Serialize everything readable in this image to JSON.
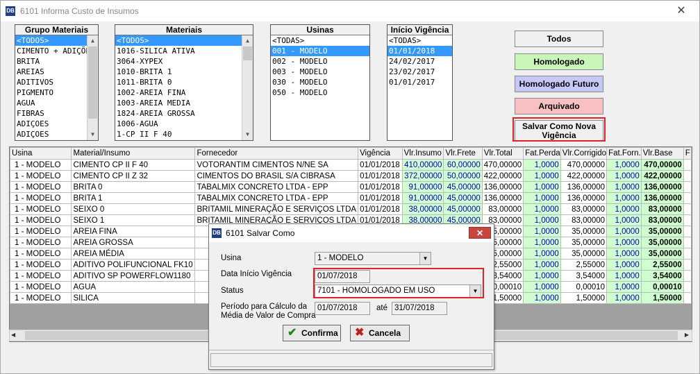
{
  "window": {
    "title": "6101 Informa Custo de Insumos",
    "icon_text": "DB",
    "close_glyph": "✕"
  },
  "lists": {
    "grupo": {
      "header": "Grupo Materiais",
      "items": [
        "<TODOS>",
        "CIMENTO + ADIÇÕES",
        "BRITA",
        "AREIAS",
        "ADITIVOS",
        "PIGMENTO",
        "AGUA",
        "FIBRAS",
        "ADIÇOES",
        "ADIÇOES"
      ],
      "selected": 0
    },
    "materiais": {
      "header": "Materiais",
      "items": [
        "<TODOS>",
        "1016-SILICA ATIVA",
        "3064-XYPEX",
        "1010-BRITA 1",
        "1011-BRITA 0",
        "1002-AREIA FINA",
        "1003-AREIA MEDIA",
        "1824-AREIA GROSSA",
        "1006-AGUA",
        "1-CP II F 40"
      ],
      "selected": 0
    },
    "usinas": {
      "header": "Usinas",
      "items": [
        "<TODAS>",
        "001 - MODELO",
        "002 - MODELO",
        "003 - MODELO",
        "030 - MODELO",
        "050 - MODELO"
      ],
      "selected": 1
    },
    "vigencia": {
      "header": "Início Vigência",
      "items": [
        "<TODAS>",
        "01/01/2018",
        "24/02/2017",
        "23/02/2017",
        "01/01/2017"
      ],
      "selected": 1
    }
  },
  "status_buttons": [
    {
      "label": "Todos",
      "bg": "#f0f0f0"
    },
    {
      "label": "Homologado",
      "bg": "#c8f5b8"
    },
    {
      "label": "Homologado Futuro",
      "bg": "#c8c8f8"
    },
    {
      "label": "Arquivado",
      "bg": "#f8c0c0"
    }
  ],
  "save_button": {
    "label_line1": "Salvar Como Nova",
    "label_line2": "Vigência"
  },
  "grid": {
    "columns": [
      "Usina",
      "Material/Insumo",
      "Fornecedor",
      "Vigência",
      "Vlr.Insumo",
      "Vlr.Frete",
      "Vlr.Total",
      "Fat.Perda",
      "Vlr.Corrigido",
      "Fat.Forn.",
      "Vlr.Base",
      "F"
    ],
    "rows": [
      [
        "1 - MODELO",
        "CIMENTO CP II F 40",
        "VOTORANTIM CIMENTOS N/NE SA",
        "01/01/2018",
        "410,00000",
        "60,00000",
        "470,00000",
        "1,0000",
        "470,00000",
        "1,0000",
        "470,00000"
      ],
      [
        "1 - MODELO",
        "CIMENTO CP II Z 32",
        "CIMENTOS DO BRASIL S/A CIBRASA",
        "01/01/2018",
        "372,00000",
        "50,00000",
        "422,00000",
        "1,0000",
        "422,00000",
        "1,0000",
        "422,00000"
      ],
      [
        "1 - MODELO",
        "BRITA 0",
        "TABALMIX CONCRETO LTDA - EPP",
        "01/01/2018",
        "91,00000",
        "45,00000",
        "136,00000",
        "1,0000",
        "136,00000",
        "1,0000",
        "136,00000"
      ],
      [
        "1 - MODELO",
        "BRITA 1",
        "TABALMIX CONCRETO LTDA - EPP",
        "01/01/2018",
        "91,00000",
        "45,00000",
        "136,00000",
        "1,0000",
        "136,00000",
        "1,0000",
        "136,00000"
      ],
      [
        "1 - MODELO",
        "SEIXO 0",
        "BRITAMIL MINERAÇÃO E SERVIÇOS LTDA",
        "01/01/2018",
        "38,00000",
        "45,00000",
        "83,00000",
        "1,0000",
        "83,00000",
        "1,0000",
        "83,00000"
      ],
      [
        "1 - MODELO",
        "SEIXO 1",
        "BRITAMIL MINERAÇÃO E SERVIÇOS LTDA",
        "01/01/2018",
        "38,00000",
        "45,00000",
        "83,00000",
        "1,0000",
        "83,00000",
        "1,0000",
        "83,00000"
      ],
      [
        "1 - MODELO",
        "AREIA FINA",
        "",
        "",
        "",
        "",
        "35,00000",
        "1,0000",
        "35,00000",
        "1,0000",
        "35,00000"
      ],
      [
        "1 - MODELO",
        "AREIA GROSSA",
        "",
        "",
        "",
        "",
        "35,00000",
        "1,0000",
        "35,00000",
        "1,0000",
        "35,00000"
      ],
      [
        "1 - MODELO",
        "AREIA MÉDIA",
        "",
        "",
        "",
        "",
        "35,00000",
        "1,0000",
        "35,00000",
        "1,0000",
        "35,00000"
      ],
      [
        "1 - MODELO",
        "ADITIVO POLIFUNCIONAL FK10",
        "",
        "",
        "",
        "",
        "2,55000",
        "1,0000",
        "2,55000",
        "1,0000",
        "2,55000"
      ],
      [
        "1 - MODELO",
        "ADITIVO SP POWERFLOW1180",
        "",
        "",
        "",
        "",
        "3,54000",
        "1,0000",
        "3,54000",
        "1,0000",
        "3,54000"
      ],
      [
        "1 - MODELO",
        "AGUA",
        "",
        "",
        "",
        "",
        "0,00010",
        "1,0000",
        "0,00010",
        "1,0000",
        "0,00010"
      ],
      [
        "1 - MODELO",
        "SILICA",
        "",
        "",
        "",
        "",
        "1,50000",
        "1,0000",
        "1,50000",
        "1,0000",
        "1,50000"
      ]
    ]
  },
  "dialog": {
    "title": "6101 Salvar Como",
    "close_glyph": "✕",
    "usina_label": "Usina",
    "usina_value": "1 - MODELO",
    "data_label": "Data Início Vigência",
    "data_value": "01/07/2018",
    "status_label": "Status",
    "status_value": "7101 - HOMOLOGADO EM USO",
    "periodo_label_1": "Período para Cálculo da",
    "periodo_label_2": "Média de Valor de Compra",
    "periodo_de": "01/07/2018",
    "periodo_ate_label": "até",
    "periodo_ate": "31/07/2018",
    "confirm_label": "Confirma",
    "cancel_label": "Cancela"
  }
}
